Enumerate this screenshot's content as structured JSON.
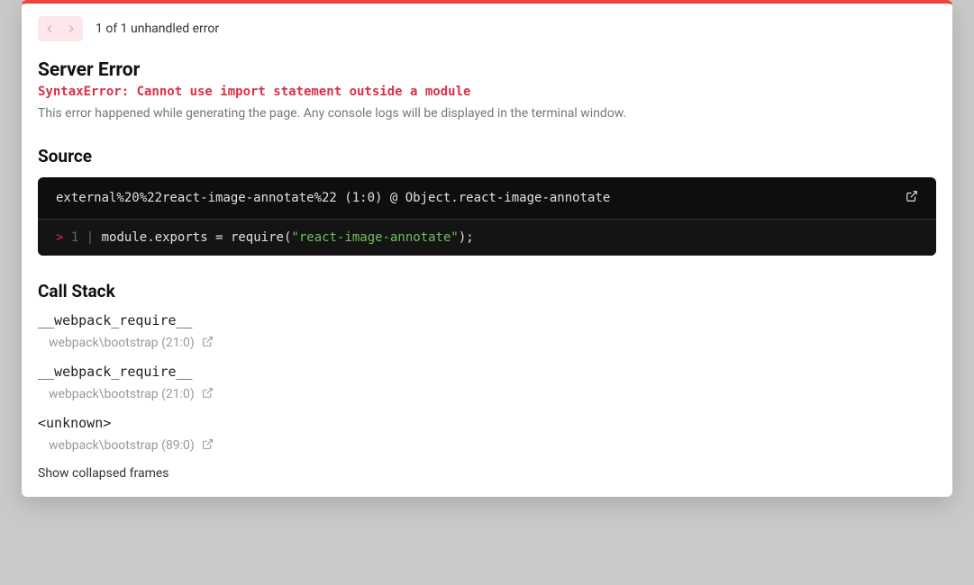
{
  "nav": {
    "count_text": "1 of 1 unhandled error"
  },
  "header": {
    "title": "Server Error",
    "error_message": "SyntaxError: Cannot use import statement outside a module",
    "description": "This error happened while generating the page. Any console logs will be displayed in the terminal window."
  },
  "source": {
    "heading": "Source",
    "location": "external%20%22react-image-annotate%22 (1:0) @ Object.react-image-annotate",
    "code": {
      "caret": ">",
      "line_no": "1",
      "sep": "|",
      "seg_module": "module",
      "seg_dot1": ".",
      "seg_exports": "exports",
      "seg_eq": " = ",
      "seg_require": "require",
      "seg_lparen": "(",
      "seg_str": "\"react-image-annotate\"",
      "seg_rparen_semi": ");"
    }
  },
  "call_stack": {
    "heading": "Call Stack",
    "frames": [
      {
        "name": "__webpack_require__",
        "location": "webpack\\bootstrap (21:0)"
      },
      {
        "name": "__webpack_require__",
        "location": "webpack\\bootstrap (21:0)"
      },
      {
        "name": "<unknown>",
        "location": "webpack\\bootstrap (89:0)"
      }
    ],
    "show_collapsed": "Show collapsed frames"
  }
}
